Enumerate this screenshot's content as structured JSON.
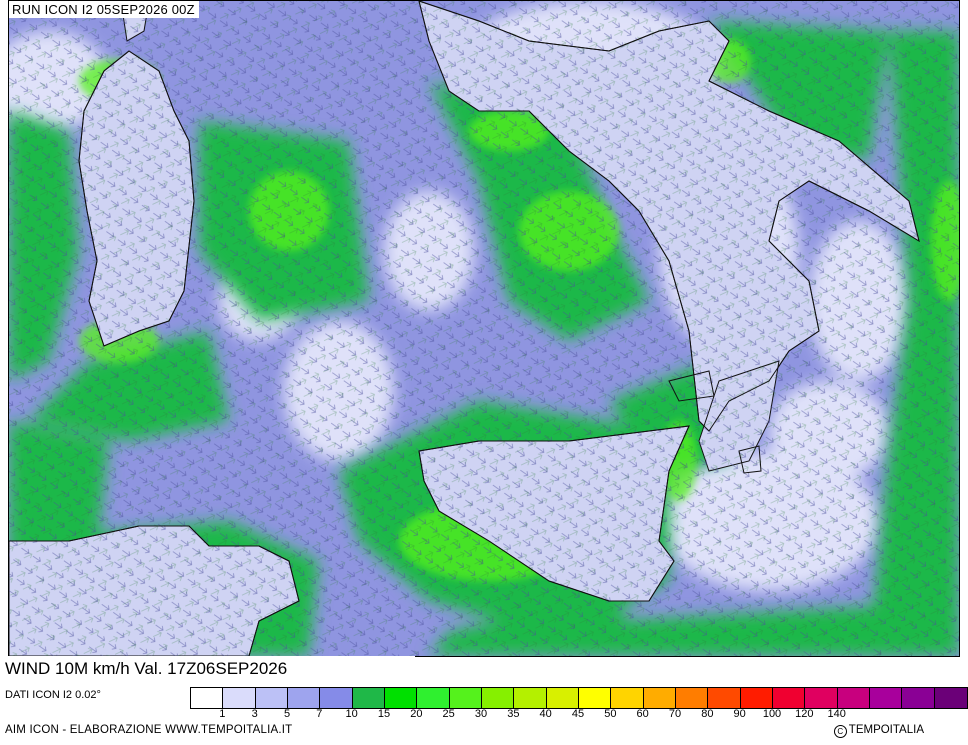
{
  "header": {
    "run_label": "RUN ICON I2 05SEP2026 00Z"
  },
  "map": {
    "variable_label": "WIND 10M km/h Val. 17Z06SEP2026",
    "source_label": "DATI ICON I2 0.02°",
    "credit_left": "AIM ICON - ELABORAZIONE WWW.TEMPOITALIA.IT",
    "credit_right": "TEMPOITALIA",
    "sea_color": "#8f95e0",
    "calm_color": "#e6e8fb",
    "land_color": "#cfd3f3",
    "coast_color": "#111111"
  },
  "legend": {
    "colors": [
      "#ffffff",
      "#dadcfb",
      "#bcc1f6",
      "#9ea4ee",
      "#858be8",
      "#1fb848",
      "#00e000",
      "#2ff02f",
      "#55f21c",
      "#86f000",
      "#b4f000",
      "#d8f000",
      "#ffff00",
      "#ffd400",
      "#ffac00",
      "#ff7d00",
      "#ff4a00",
      "#ff1c00",
      "#f00030",
      "#e00060",
      "#c8007e",
      "#a8009c",
      "#8a0095",
      "#6b0078"
    ],
    "labels": [
      "1",
      "3",
      "5",
      "7",
      "10",
      "15",
      "20",
      "25",
      "30",
      "35",
      "40",
      "45",
      "50",
      "60",
      "70",
      "80",
      "90",
      "100",
      "120",
      "140"
    ]
  }
}
